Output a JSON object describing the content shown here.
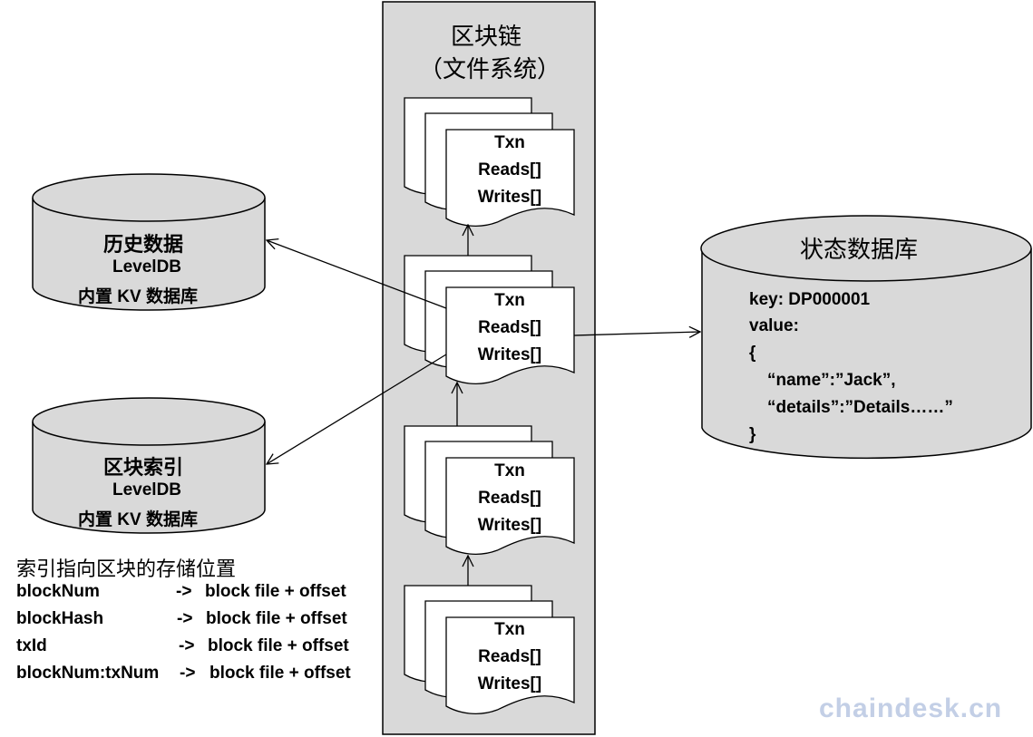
{
  "chain_column": {
    "title_line1": "区块链",
    "title_line2": "（文件系统）"
  },
  "block_doc": {
    "line1": "Txn",
    "line2": "Reads[]",
    "line3": "Writes[]"
  },
  "history_db": {
    "title": "历史数据",
    "engine": "LevelDB",
    "desc": "内置 KV 数据库"
  },
  "block_index_db": {
    "title": "区块索引",
    "engine": "LevelDB",
    "desc": "内置 KV 数据库"
  },
  "state_db": {
    "title": "状态数据库",
    "lines": [
      "key:   DP000001",
      "value:",
      "{",
      "“name”:”Jack”,",
      "“details”:”Details……”",
      "}"
    ]
  },
  "index_notes": {
    "heading": "索引指向区块的存储位置",
    "rows": [
      {
        "key": "blockNum",
        "arrow": "->",
        "target": "block file + offset"
      },
      {
        "key": "blockHash",
        "arrow": "->",
        "target": "block file + offset"
      },
      {
        "key": "txId",
        "arrow": "->",
        "target": "block file + offset"
      },
      {
        "key": "blockNum:txNum",
        "arrow": "->",
        "target": "block file + offset"
      }
    ]
  },
  "watermark": "chaindesk.cn"
}
